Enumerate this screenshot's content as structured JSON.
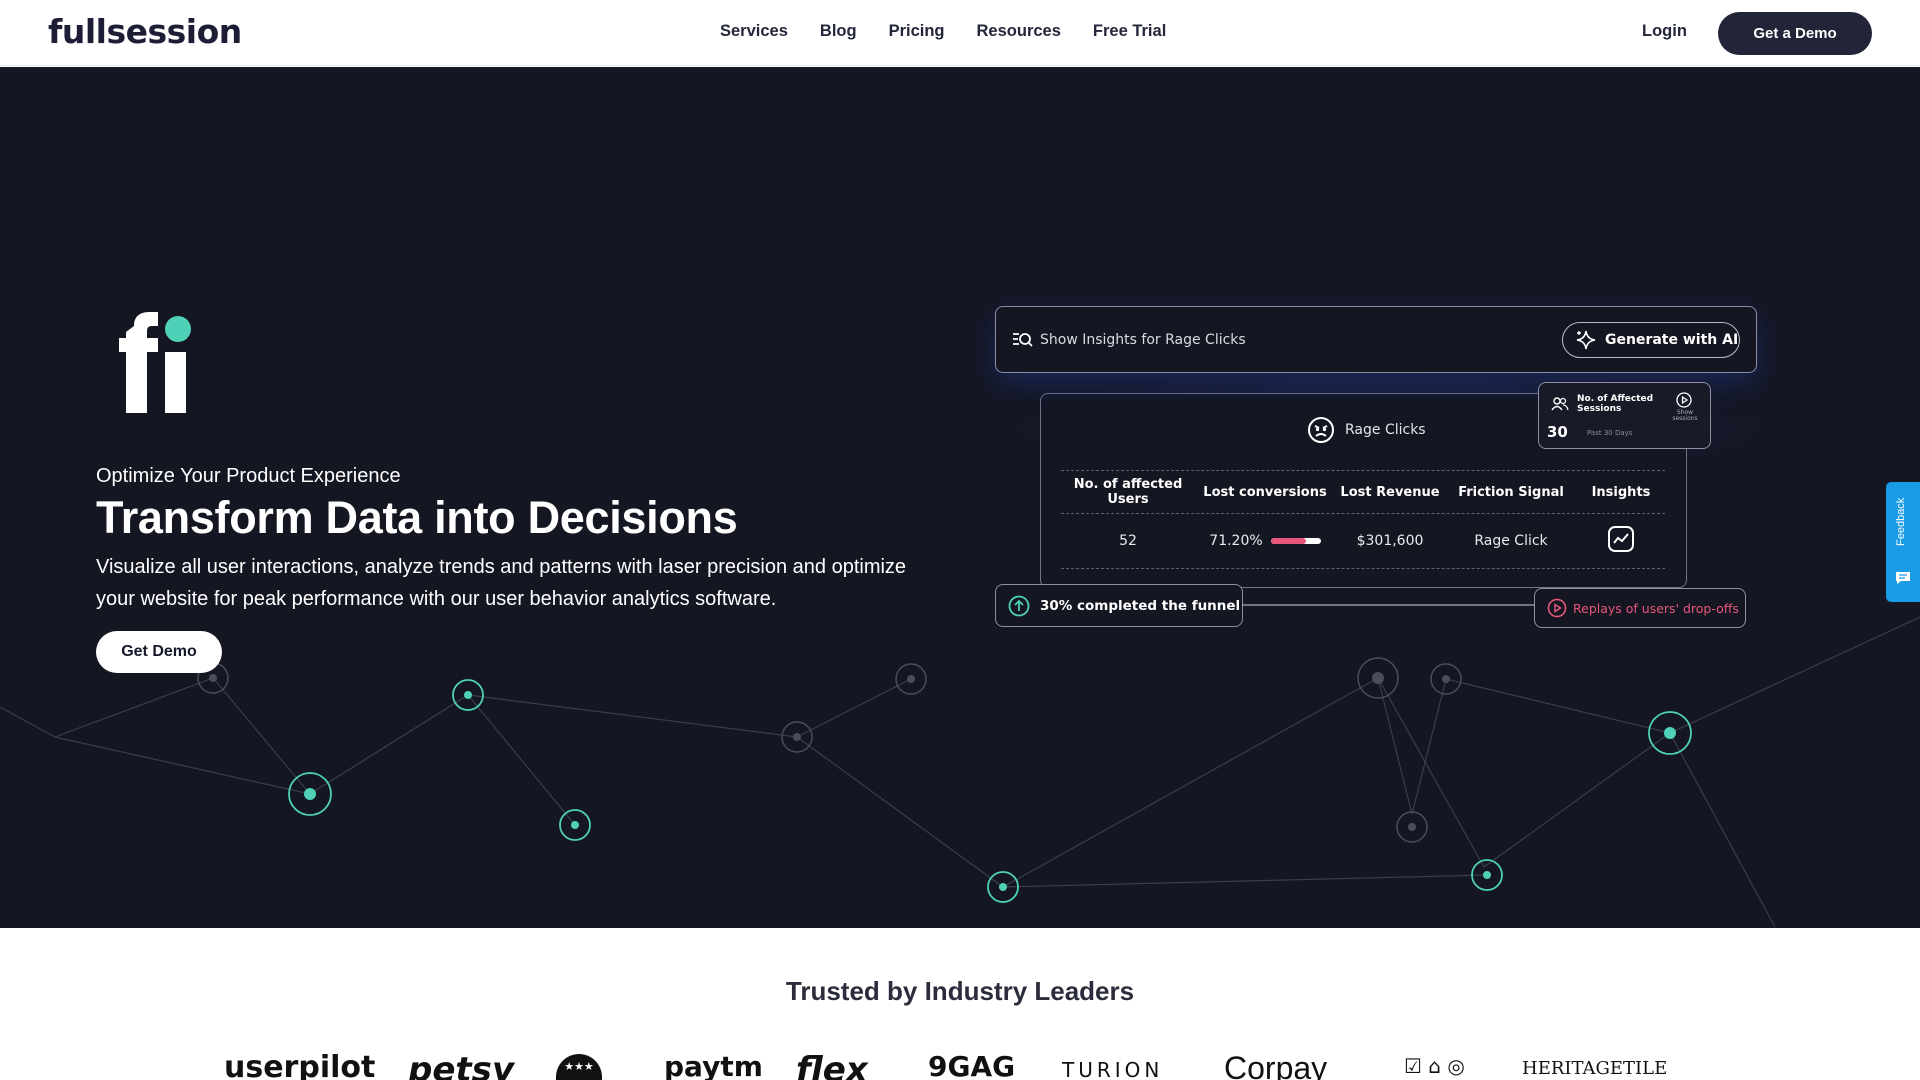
{
  "header": {
    "logo": "fullsession",
    "nav": [
      "Services",
      "Blog",
      "Pricing",
      "Resources",
      "Free Trial"
    ],
    "login": "Login",
    "cta": "Get a Demo"
  },
  "hero": {
    "tagline": "Optimize Your Product Experience",
    "headline": "Transform Data into Decisions",
    "description": "Visualize all user interactions, analyze trends and patterns with laser precision and optimize your website for peak performance with our user behavior analytics software.",
    "cta": "Get Demo",
    "accent_color": "#4fd1b8",
    "background_color": "#141622"
  },
  "insight_card": {
    "search_text": "Show Insights  for Rage Clicks",
    "generate_label": "Generate with AI",
    "panel_title": "Rage Clicks",
    "table": {
      "headers": [
        "No. of affected Users",
        "Lost conversions",
        "Lost Revenue",
        "Friction Signal",
        "Insights"
      ],
      "row": {
        "users": "52",
        "lost_conversions": "71.20%",
        "lost_conversion_fraction": 0.712,
        "lost_revenue": "$301,600",
        "friction_signal": "Rage Click"
      }
    },
    "sessions": {
      "label": "No. of Affected Sessions",
      "show": "Show sessions",
      "count": "30",
      "period": "Past 30 Days"
    },
    "funnel": "30% completed the funnel",
    "replays": "Replays of users' drop-offs",
    "alert_color": "#e8577b"
  },
  "feedback": {
    "label": "Feedback"
  },
  "trusted": {
    "title": "Trusted by Industry Leaders",
    "brands": [
      "userpilot",
      "petsy",
      "★★★",
      "paytm",
      "flex",
      "9GAG",
      "TURION",
      "Corpay",
      "☑ ⌂ ◎",
      "HERITAGETILE"
    ]
  }
}
